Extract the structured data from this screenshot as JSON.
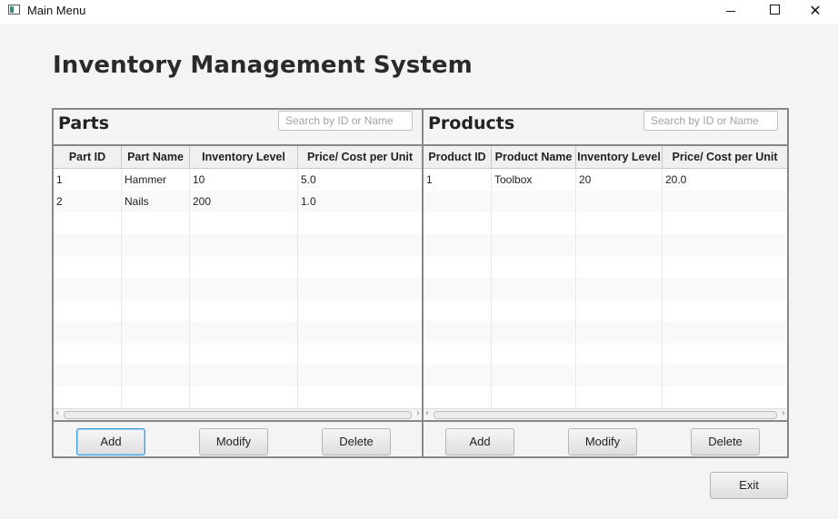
{
  "window": {
    "title": "Main Menu",
    "controls": [
      "minimize-icon",
      "maximize-icon",
      "close-icon"
    ]
  },
  "heading": "Inventory Management System",
  "parts": {
    "title": "Parts",
    "search_placeholder": "Search by ID or Name",
    "columns": [
      "Part ID",
      "Part Name",
      "Inventory Level",
      "Price/ Cost per Unit"
    ],
    "rows": [
      [
        "1",
        "Hammer",
        "10",
        "5.0"
      ],
      [
        "2",
        "Nails",
        "200",
        "1.0"
      ]
    ],
    "buttons": {
      "add": "Add",
      "modify": "Modify",
      "delete": "Delete"
    }
  },
  "products": {
    "title": "Products",
    "search_placeholder": "Search by ID or Name",
    "columns": [
      "Product ID",
      "Product Name",
      "Inventory Level",
      "Price/ Cost per Unit"
    ],
    "rows": [
      [
        "1",
        "Toolbox",
        "20",
        "20.0"
      ]
    ],
    "buttons": {
      "add": "Add",
      "modify": "Modify",
      "delete": "Delete"
    }
  },
  "exit_label": "Exit",
  "colors": {
    "focus_border": "#3c9ee0",
    "pane_border": "#888888"
  }
}
